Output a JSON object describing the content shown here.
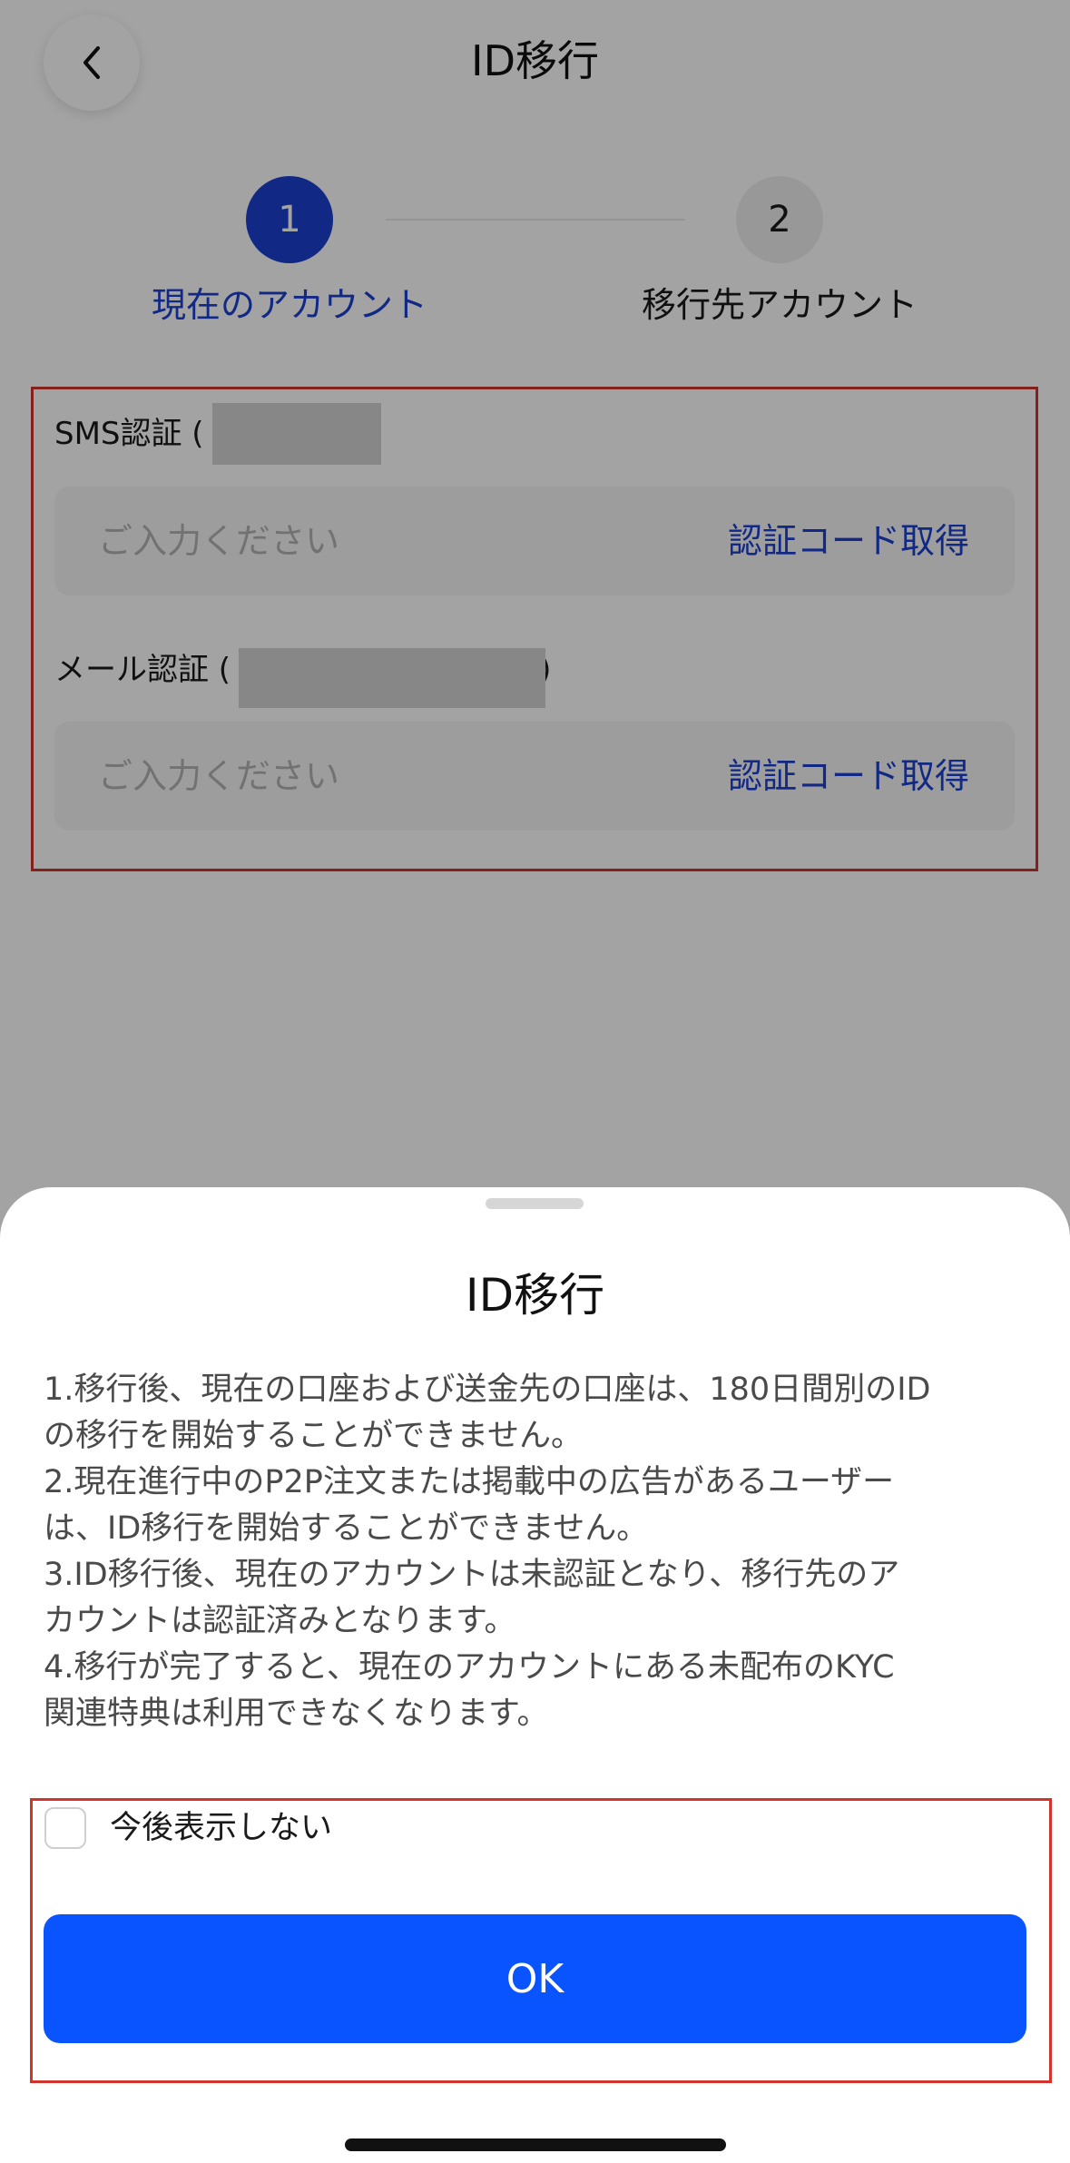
{
  "header": {
    "title": "ID移行",
    "back_icon": "chevron-left-icon"
  },
  "stepper": {
    "steps": [
      {
        "number": "1",
        "label": "現在のアカウント",
        "active": true
      },
      {
        "number": "2",
        "label": "移行先アカウント",
        "active": false
      }
    ]
  },
  "form": {
    "sms": {
      "label_prefix": "SMS認証 (",
      "label_suffix": ")",
      "placeholder": "ご入力ください",
      "get_code_label": "認証コード取得"
    },
    "email": {
      "label_prefix": "メール認証 (",
      "label_suffix": ")",
      "placeholder": "ご入力ください",
      "get_code_label": "認証コード取得"
    }
  },
  "sheet": {
    "title": "ID移行",
    "notice_lines": [
      "1.移行後、現在の口座および送金先の口座は、180日間別のID",
      "の移行を開始することができません。",
      "2.現在進行中のP2P注文または掲載中の広告があるユーザー",
      "は、ID移行を開始することができません。",
      "3.ID移行後、現在のアカウントは未認証となり、移行先のア",
      "カウントは認証済みとなります。",
      "4.移行が完了すると、現在のアカウントにある未配布のKYC",
      "関連特典は利用できなくなります。"
    ],
    "dont_show_again_label": "今後表示しない",
    "dont_show_again_checked": false,
    "ok_label": "OK"
  },
  "colors": {
    "accent": "#1c3fd1",
    "primary_button": "#0a54ff",
    "highlight_border": "#d0342c",
    "overlay": "rgba(0,0,0,0.36)"
  }
}
